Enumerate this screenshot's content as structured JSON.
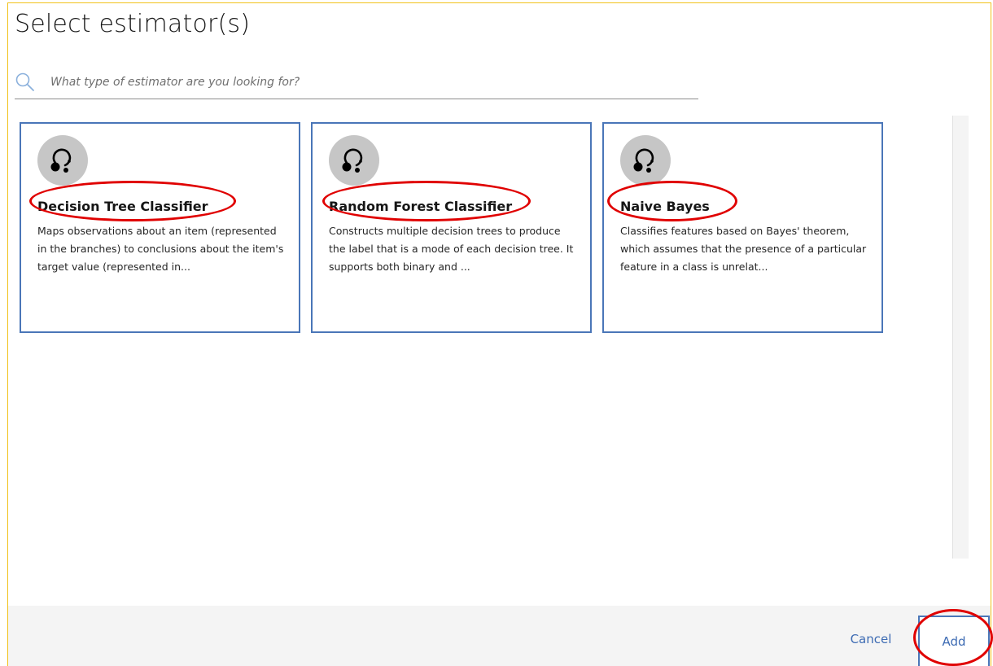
{
  "dialog": {
    "title": "Select estimator(s)"
  },
  "search": {
    "placeholder": "What type of estimator are you looking for?"
  },
  "estimators": [
    {
      "title": "Decision Tree Classifier",
      "description": "Maps observations about an item (represented in the branches) to conclusions about the item's target value (represented in...",
      "icon": "estimator-icon"
    },
    {
      "title": "Random Forest Classifier",
      "description": "Constructs multiple decision trees to produce the label that is a mode of each decision tree. It supports both binary and ...",
      "icon": "estimator-icon"
    },
    {
      "title": "Naive Bayes",
      "description": "Classifies features based on Bayes' theorem, which assumes that the presence of a particular feature in a class is unrelat...",
      "icon": "estimator-icon"
    }
  ],
  "footer": {
    "cancel_label": "Cancel",
    "add_label": "Add"
  },
  "colors": {
    "card_border": "#4a76b8",
    "link_blue": "#3d6bb3",
    "highlight_red": "#e00000",
    "frame_yellow": "#f1c21b"
  }
}
